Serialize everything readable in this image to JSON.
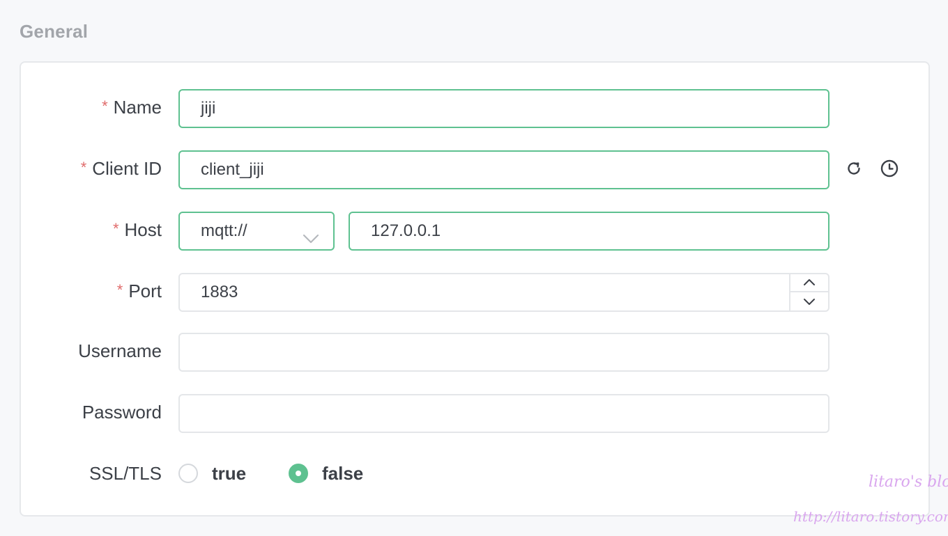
{
  "section": {
    "title": "General"
  },
  "form": {
    "name": {
      "label": "Name",
      "value": "jiji"
    },
    "client_id": {
      "label": "Client ID",
      "value": "client_jiji"
    },
    "host": {
      "label": "Host",
      "protocol": "mqtt://",
      "value": "127.0.0.1"
    },
    "port": {
      "label": "Port",
      "value": "1883"
    },
    "username": {
      "label": "Username",
      "value": ""
    },
    "password": {
      "label": "Password",
      "value": ""
    },
    "ssl_tls": {
      "label": "SSL/TLS",
      "options": [
        "true",
        "false"
      ],
      "selected": "false"
    }
  },
  "required_mark": "*",
  "icons": {
    "refresh": "refresh-icon",
    "history": "clock-icon",
    "select": "chevron-down-icon",
    "step_up": "chevron-up-icon",
    "step_down": "chevron-down-icon"
  },
  "colors": {
    "accent": "#5ec190",
    "required": "#e06b6b",
    "section_title": "#a2a5aa",
    "text": "#3c4047",
    "watermark": "#d9a6ee"
  },
  "watermark": {
    "line1": "litaro's blog",
    "line2": "http://litaro.tistory.com/"
  }
}
